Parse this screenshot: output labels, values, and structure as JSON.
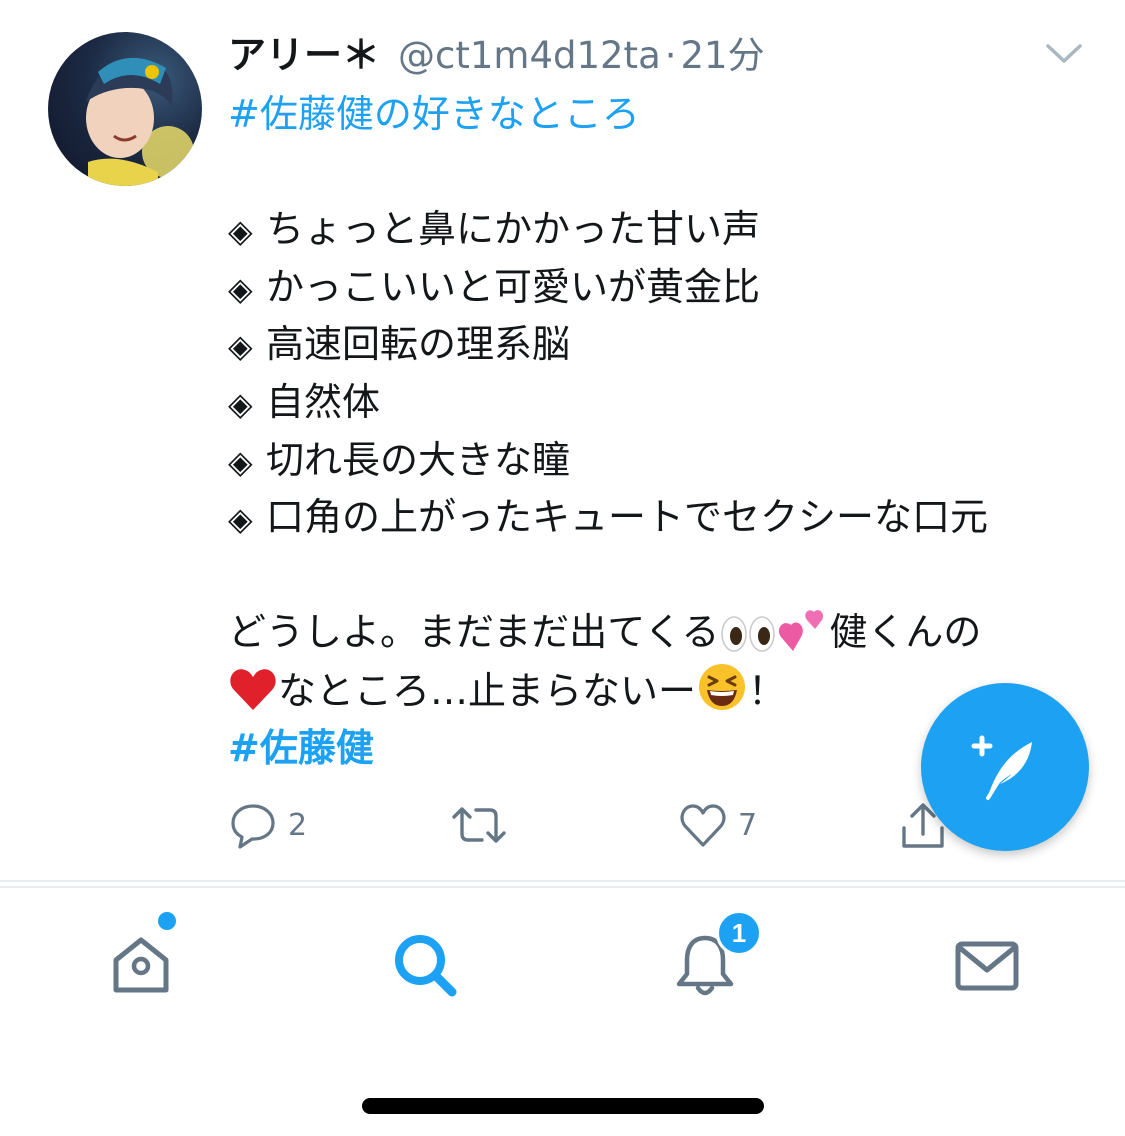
{
  "tweet": {
    "display_name": "アリー＊",
    "handle": "@ct1m4d12ta",
    "separator": "·",
    "time": "21分",
    "hashtag_top": "#佐藤健の好きなところ",
    "bullet_char": "◈",
    "bullets": [
      "ちょっと鼻にかかった甘い声",
      "かっこいいと可愛いが黄金比",
      "高速回転の理系脳",
      "自然体",
      "切れ長の大きな瞳",
      "口角の上がったキュートでセクシーな口元"
    ],
    "para_line1_a": "どうしよ。まだまだ出てくる",
    "para_line1_b": "健くんの",
    "para_line2_a": "なところ…止まらないー",
    "para_line2_b": "！",
    "emojis": [
      "eyes",
      "two-hearts",
      "red-heart",
      "grinning-squinting-face"
    ],
    "hashtag_bottom": "#佐藤健",
    "actions": {
      "reply_count": "2",
      "retweet_count": "",
      "like_count": "7"
    }
  },
  "tabbar": {
    "items": [
      "home",
      "search",
      "notifications",
      "messages"
    ],
    "notifications_badge": "1"
  },
  "colors": {
    "accent": "#1da1f2",
    "text": "#14171a",
    "secondary": "#657786",
    "icon": "#657786"
  }
}
